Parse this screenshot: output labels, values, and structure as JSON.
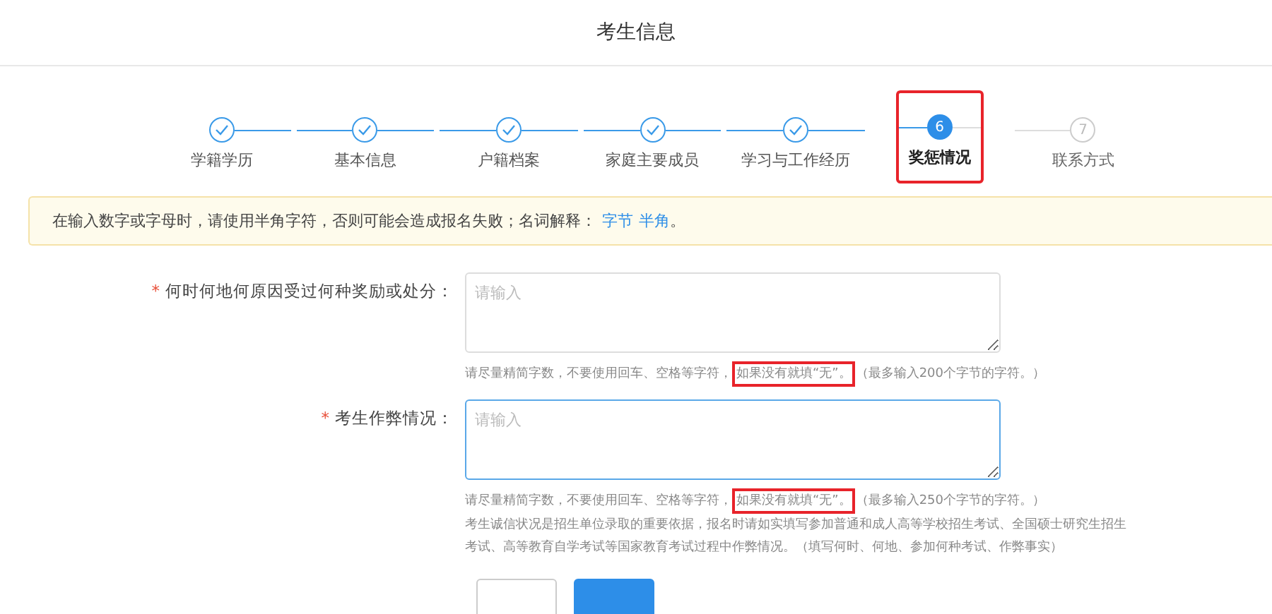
{
  "header": {
    "title": "考生信息"
  },
  "steps": [
    {
      "label": "学籍学历",
      "completed": true,
      "selected": false,
      "highlighted": false
    },
    {
      "label": "基本信息",
      "completed": true,
      "selected": false,
      "highlighted": false
    },
    {
      "label": "户籍档案",
      "completed": true,
      "selected": false,
      "highlighted": false
    },
    {
      "label": "家庭主要成员",
      "completed": true,
      "selected": false,
      "highlighted": false
    },
    {
      "label": "学习与工作经历",
      "completed": true,
      "selected": false,
      "highlighted": false
    },
    {
      "number": "6",
      "label": "奖惩情况",
      "completed": false,
      "selected": true,
      "highlighted": true
    },
    {
      "number": "7",
      "label": "联系方式",
      "completed": false,
      "selected": false,
      "highlighted": false
    }
  ],
  "notice": {
    "text": "在输入数字或字母时，请使用半角字符，否则可能会造成报名失败；名词解释：",
    "links": [
      "字节",
      "半角"
    ],
    "end": "。"
  },
  "fields": [
    {
      "label": "何时何地何原因受过何种奖励或处分：",
      "required_mark": "*",
      "placeholder": "请输入",
      "focused": false,
      "hint_before": "请尽量精简字数，不要使用回车、空格等字符，",
      "hint_highlighted": "如果没有就填“无”。",
      "hint_after": "（最多输入200个字节的字符。）"
    },
    {
      "label": "考生作弊情况：",
      "required_mark": "*",
      "placeholder": "请输入",
      "focused": true,
      "hint_before": "请尽量精简字数，不要使用回车、空格等字符，",
      "hint_highlighted": "如果没有就填“无”。",
      "hint_after": "（最多输入250个字节的字符。）",
      "note": "考生诚信状况是招生单位录取的重要依据，报名时请如实填写参加普通和成人高等学校招生考试、全国硕士研究生招生考试、高等教育自学考试等国家教育考试过程中作弊情况。（填写何时、何地、参加何种考试、作弊事实）"
    }
  ],
  "buttons": [
    {
      "kind": "secondary"
    },
    {
      "kind": "primary"
    }
  ]
}
